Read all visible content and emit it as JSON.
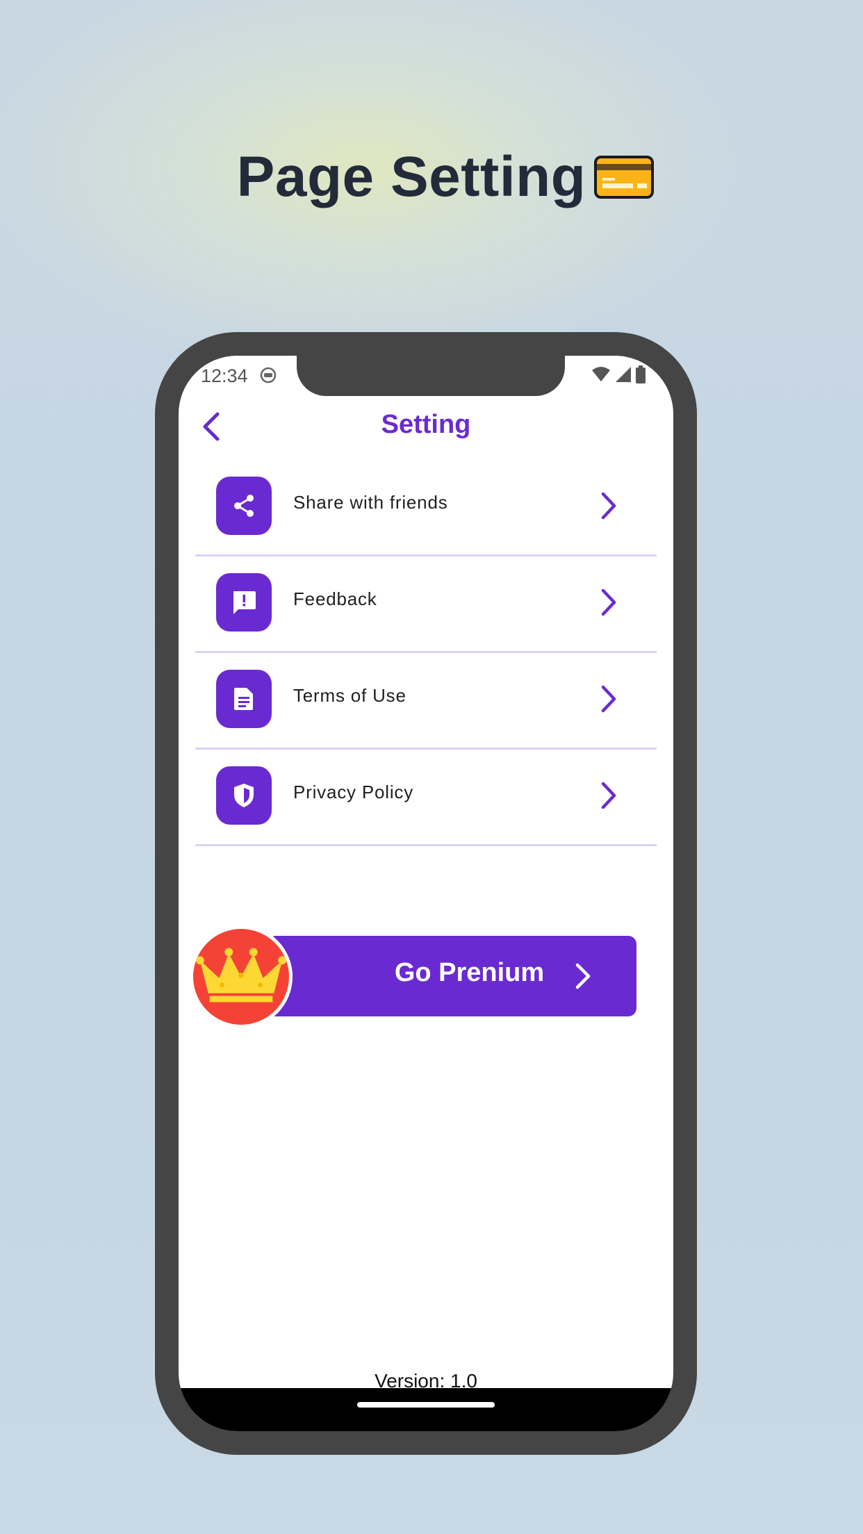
{
  "promo": {
    "title": "Page Setting",
    "title_icon": "credit-card-icon"
  },
  "status_bar": {
    "time": "12:34",
    "icons": [
      "android-icon",
      "wifi-icon",
      "signal-icon",
      "battery-icon"
    ]
  },
  "header": {
    "back_icon": "chevron-left-icon",
    "title": "Setting"
  },
  "menu": {
    "items": [
      {
        "label": "Share with friends",
        "icon": "share-icon"
      },
      {
        "label": "Feedback",
        "icon": "feedback-icon"
      },
      {
        "label": "Terms of Use",
        "icon": "document-icon"
      },
      {
        "label": "Privacy Policy",
        "icon": "shield-icon"
      }
    ]
  },
  "premium": {
    "label": "Go Prenium",
    "icon": "crown-icon"
  },
  "footer": {
    "version": "Version: 1.0"
  },
  "colors": {
    "accent": "#6a2ad1",
    "divider": "#ddd1f6",
    "premium_badge": "#f44336",
    "crown": "#fdd835",
    "phone_frame": "#454545",
    "title_text": "#232b3a"
  }
}
